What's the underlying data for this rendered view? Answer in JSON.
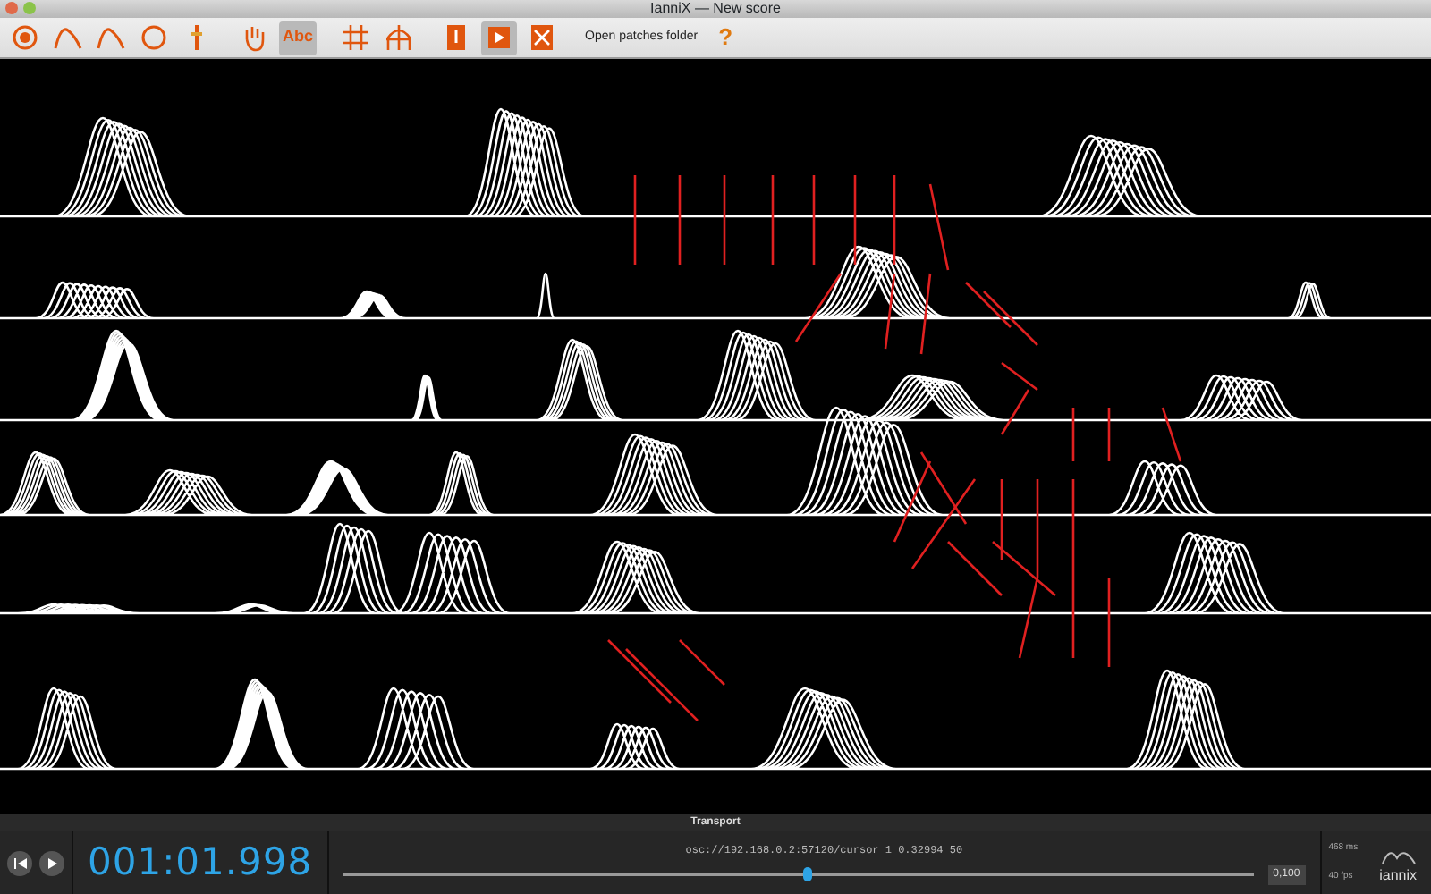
{
  "window": {
    "title": "IanniX — New score"
  },
  "toolbar": [
    {
      "kind": "target",
      "selected": false
    },
    {
      "kind": "curve",
      "selected": false
    },
    {
      "kind": "curve",
      "selected": false
    },
    {
      "kind": "circle",
      "selected": false
    },
    {
      "kind": "cursor",
      "selected": false
    },
    {
      "kind": "hand",
      "selected": false
    },
    {
      "kind": "text",
      "label": "Abc",
      "selected": true
    },
    {
      "kind": "grid",
      "selected": false
    },
    {
      "kind": "grid2",
      "selected": false
    },
    {
      "kind": "square",
      "selected": false
    },
    {
      "kind": "play",
      "selected": true
    },
    {
      "kind": "expand",
      "selected": false
    },
    {
      "kind": "link",
      "label": "Open patches folder",
      "selected": false
    },
    {
      "kind": "help",
      "label": "?",
      "selected": false
    }
  ],
  "transport": {
    "title": "Transport",
    "time": "001:01.998",
    "message": "osc://192.168.0.2:57120/cursor 1 0.32994 50",
    "speed": {
      "level": 0.51,
      "value": "0,100"
    },
    "latency": "468 ms",
    "fps": "40 fps",
    "logo": "iannix"
  }
}
